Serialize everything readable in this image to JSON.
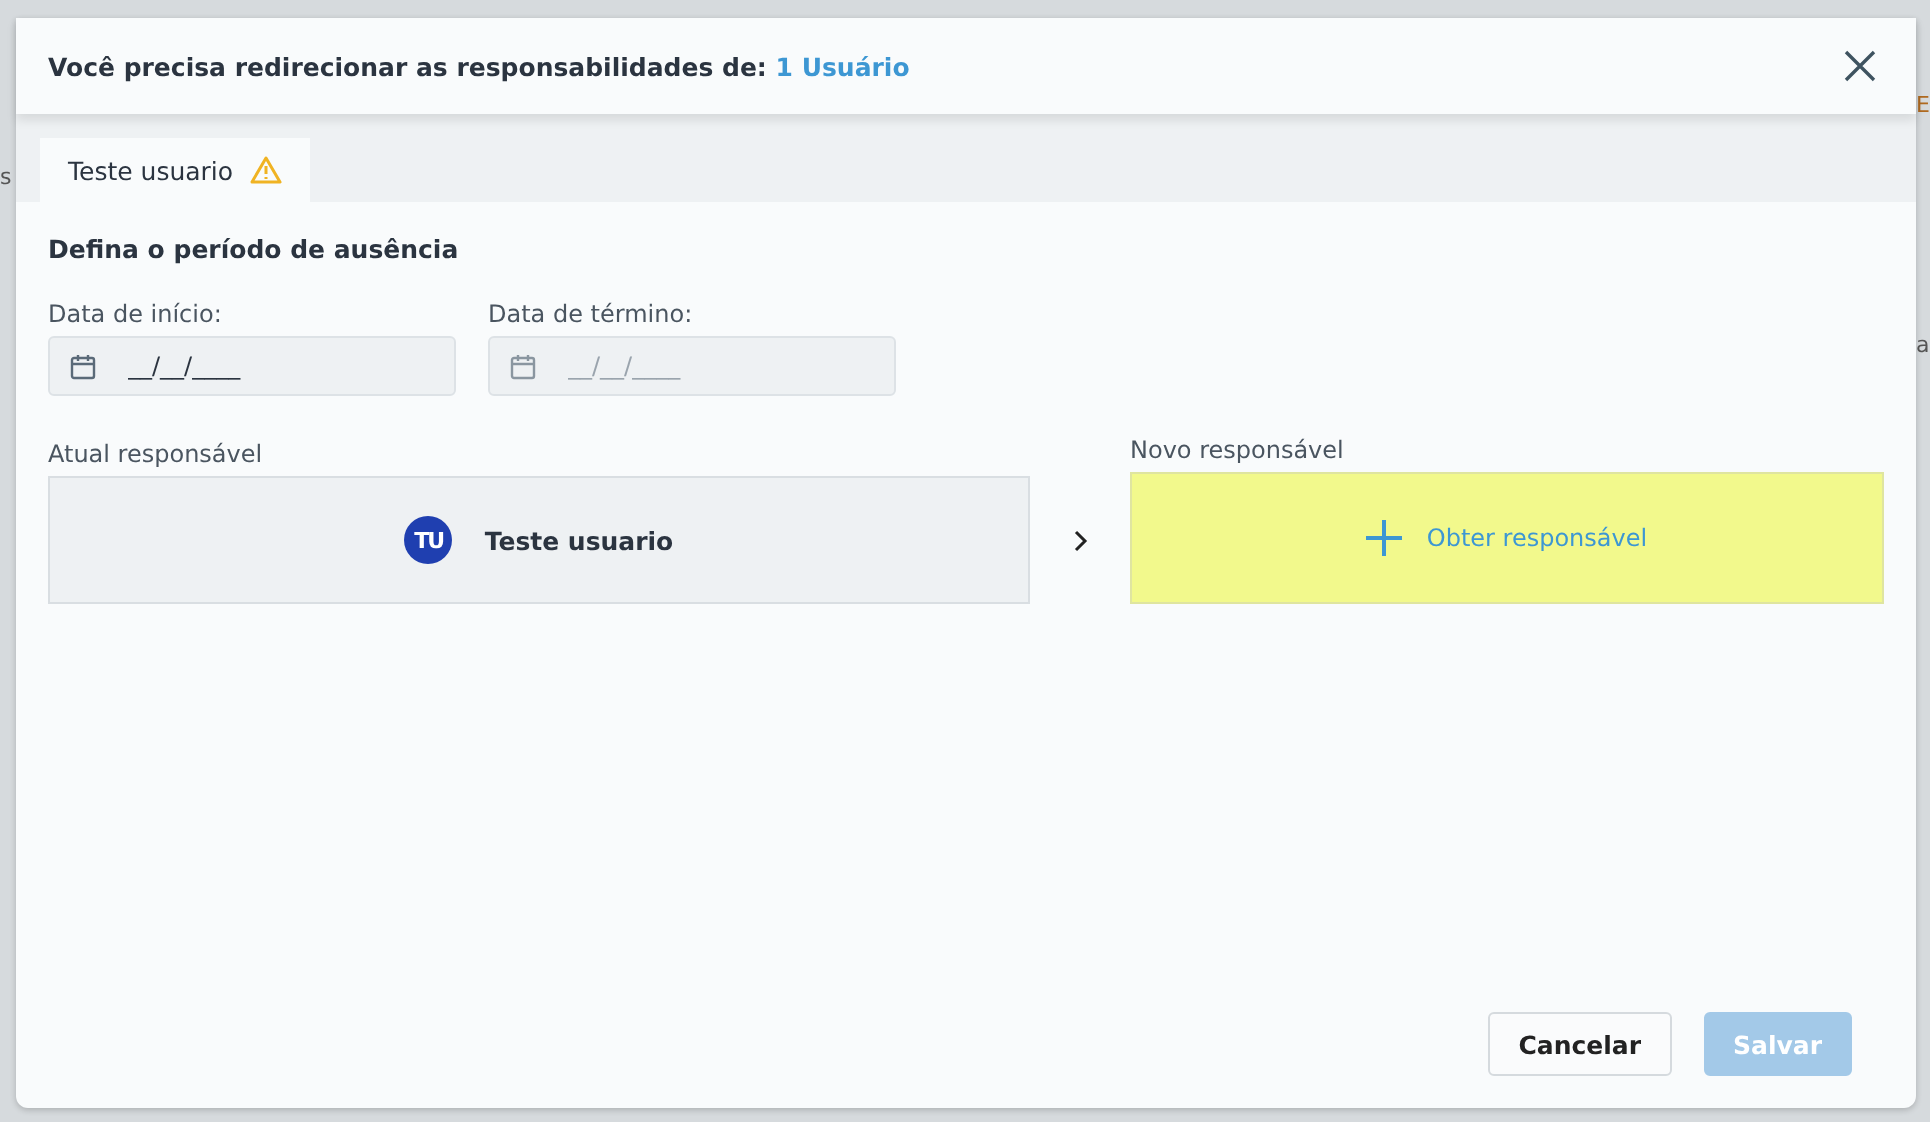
{
  "background": {
    "fragments": [
      "s",
      "E",
      "a"
    ]
  },
  "dialog": {
    "title_prefix": "Você precisa redirecionar as responsabilidades de:",
    "title_link": "1 Usuário"
  },
  "tabs": [
    {
      "label": "Teste usuario",
      "selected": true,
      "warning": true
    }
  ],
  "section_title": "Defina o período de ausência",
  "dates": [
    {
      "label": "Data de início:",
      "placeholder": "__/__/____",
      "disabled": false
    },
    {
      "label": "Data de término:",
      "placeholder": "__/__/____",
      "disabled": true
    }
  ],
  "current": {
    "label": "Atual responsável",
    "initials": "TU",
    "name": "Teste usuario"
  },
  "new": {
    "label": "Novo responsável",
    "action": "Obter responsável"
  },
  "buttons": [
    {
      "label": "Cancelar",
      "kind": "secondary",
      "disabled": false
    },
    {
      "label": "Salvar",
      "kind": "primary",
      "disabled": true
    }
  ]
}
